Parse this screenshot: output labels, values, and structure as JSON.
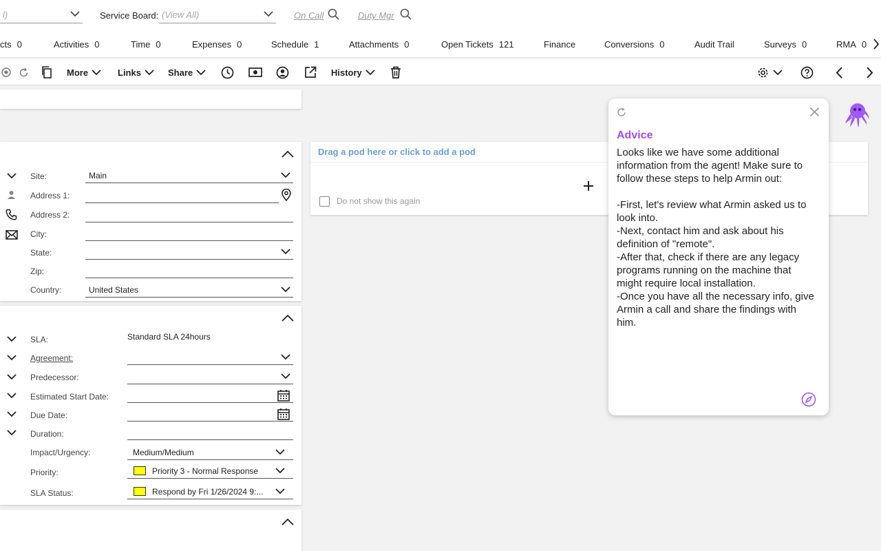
{
  "filters": {
    "first_select_value": "l)",
    "service_board_label": "Service Board:",
    "service_board_value": "(View All)",
    "on_call_label": "On Call",
    "duty_mgr_label": "Duty Mgr"
  },
  "tabs": [
    {
      "label": "cts",
      "count": "0"
    },
    {
      "label": "Activities",
      "count": "0"
    },
    {
      "label": "Time",
      "count": "0"
    },
    {
      "label": "Expenses",
      "count": "0"
    },
    {
      "label": "Schedule",
      "count": "1"
    },
    {
      "label": "Attachments",
      "count": "0"
    },
    {
      "label": "Open Tickets",
      "count": "121"
    },
    {
      "label": "Finance",
      "count": ""
    },
    {
      "label": "Conversions",
      "count": "0"
    },
    {
      "label": "Audit Trail",
      "count": ""
    },
    {
      "label": "Surveys",
      "count": "0"
    },
    {
      "label": "RMA",
      "count": "0"
    }
  ],
  "toolbar": {
    "more_label": "More",
    "links_label": "Links",
    "share_label": "Share",
    "history_label": "History"
  },
  "address": {
    "site_label": "Site:",
    "site_value": "Main",
    "address1_label": "Address 1:",
    "address2_label": "Address 2:",
    "city_label": "City:",
    "state_label": "State:",
    "zip_label": "Zip:",
    "country_label": "Country:",
    "country_value": "United States"
  },
  "sla": {
    "sla_label": "SLA:",
    "sla_value": "Standard SLA 24hours",
    "agreement_label": "Agreement:",
    "predecessor_label": "Predecessor:",
    "est_start_label": "Estimated Start Date:",
    "due_date_label": "Due Date:",
    "duration_label": "Duration:",
    "impact_label": "Impact/Urgency:",
    "impact_value": "Medium/Medium",
    "priority_label": "Priority:",
    "priority_value": "Priority 3 - Normal Response",
    "sla_status_label": "SLA Status:",
    "sla_status_value": "Respond by Fri 1/26/2024 9:..."
  },
  "pod": {
    "header": "Drag a pod here or click to add a pod",
    "checkbox_label": "Do not show this again"
  },
  "advice": {
    "title": "Advice",
    "body": "Looks like we have some additional information from the agent! Make sure to follow these steps to help Armin out:\n\n-First, let's review what Armin asked us to look into.\n-Next, contact him and ask about his definition of \"remote\".\n-After that, check if there are any legacy programs running on the machine that might require local installation.\n-Once you have all the necessary info, give Armin a call and share the findings with him."
  },
  "colors": {
    "accent_purple": "#9b4dff",
    "pod_link_blue": "#6a9fd8",
    "priority_yellow": "#ffff00"
  }
}
